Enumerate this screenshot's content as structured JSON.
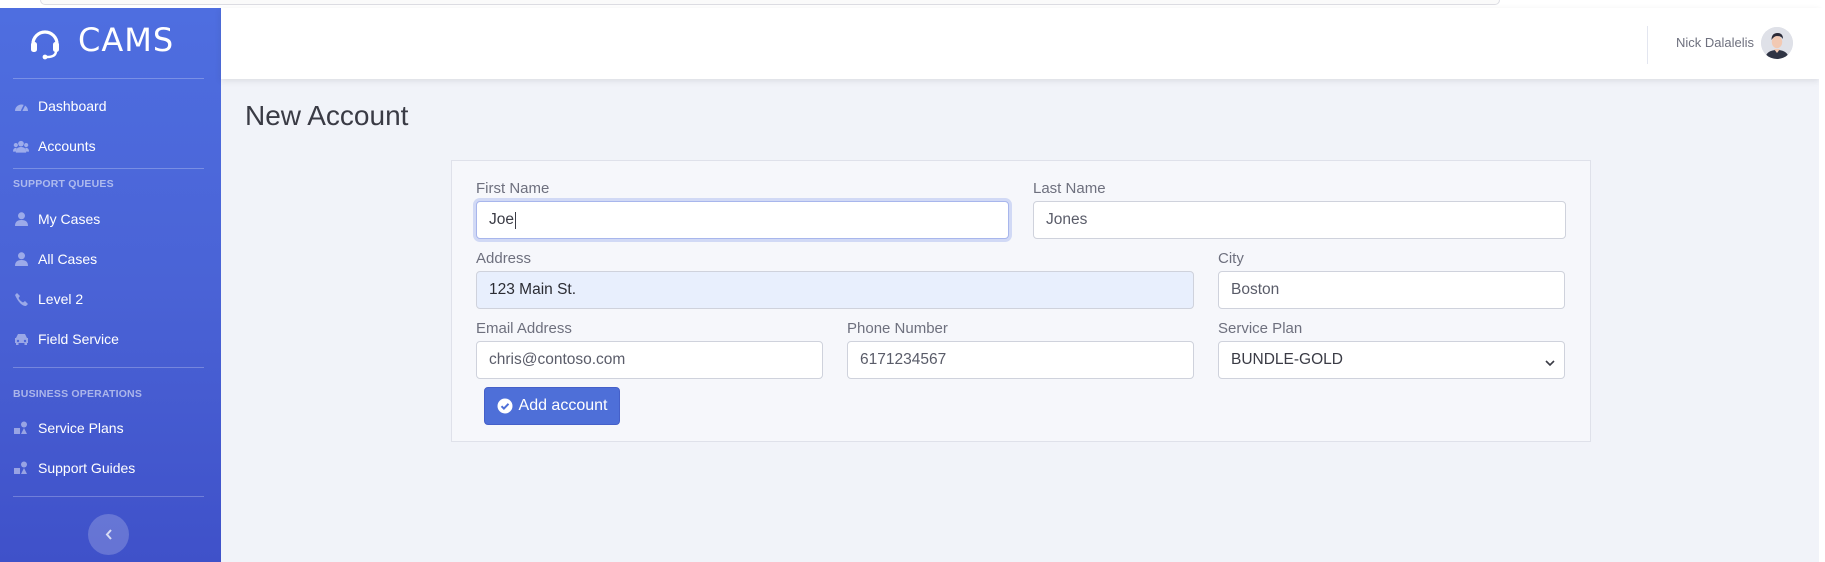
{
  "app": {
    "brand": "CAMS",
    "brand_icon": "headset-icon"
  },
  "sidebar": {
    "items_top": [
      {
        "label": "Dashboard",
        "icon": "tachometer-icon"
      },
      {
        "label": "Accounts",
        "icon": "users-icon"
      }
    ],
    "support_heading": "SUPPORT QUEUES",
    "support_items": [
      {
        "label": "My Cases",
        "icon": "user-icon"
      },
      {
        "label": "All Cases",
        "icon": "user-icon"
      },
      {
        "label": "Level 2",
        "icon": "phone-icon"
      },
      {
        "label": "Field Service",
        "icon": "car-icon"
      }
    ],
    "business_heading": "BUSINESS OPERATIONS",
    "business_items": [
      {
        "label": "Service Plans",
        "icon": "shapes-icon"
      },
      {
        "label": "Support Guides",
        "icon": "shapes-icon"
      }
    ],
    "toggle_icon": "chevron-left-icon"
  },
  "topbar": {
    "user_name": "Nick Dalalelis"
  },
  "page": {
    "title": "New Account"
  },
  "form": {
    "first_name": {
      "label": "First Name",
      "value": "Joe"
    },
    "last_name": {
      "label": "Last Name",
      "value": "Jones"
    },
    "address": {
      "label": "Address",
      "value": "123 Main St."
    },
    "city": {
      "label": "City",
      "value": "Boston"
    },
    "email": {
      "label": "Email Address",
      "value": "chris@contoso.com"
    },
    "phone": {
      "label": "Phone Number",
      "value": "6171234567"
    },
    "service_plan": {
      "label": "Service Plan",
      "value": "BUNDLE-GOLD"
    },
    "submit_label": "Add account"
  },
  "colors": {
    "sidebar_top": "#4e6ee0",
    "sidebar_bottom": "#3f51c9",
    "primary_button": "#4e6fd8",
    "background": "#f1f3f9"
  }
}
